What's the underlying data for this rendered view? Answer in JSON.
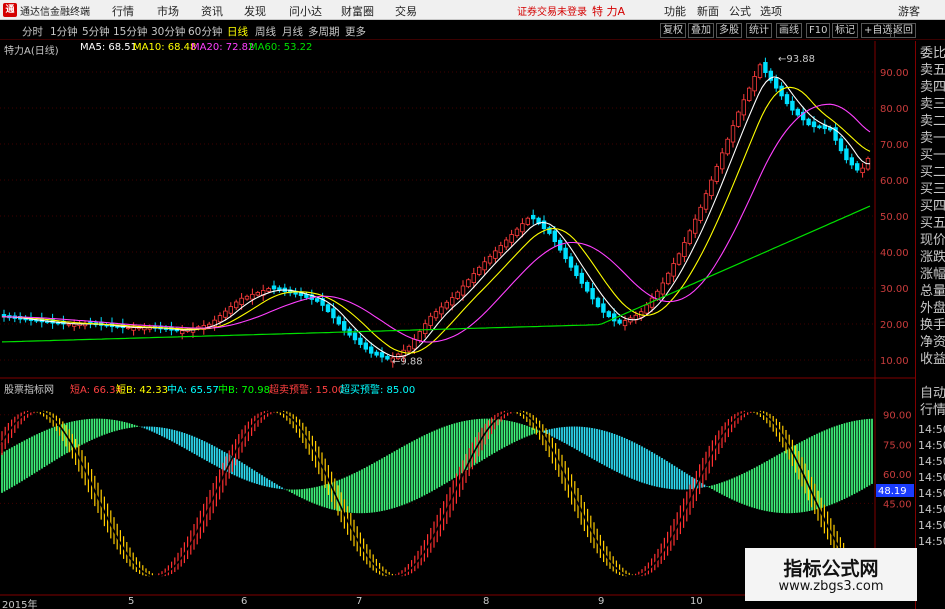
{
  "titlebar": {
    "app_name": "通达信金融终端",
    "menu": [
      "行情",
      "市场",
      "资讯",
      "发现",
      "问小达",
      "财富圈",
      "交易"
    ],
    "notice": "证券交易未登录",
    "stock": "特 力A",
    "right_menu": [
      "功能",
      "新面",
      "公式",
      "选项"
    ],
    "guest": "游客"
  },
  "toolbar": {
    "periods": [
      "分时",
      "1分钟",
      "5分钟",
      "15分钟",
      "30分钟",
      "60分钟",
      "日线",
      "周线",
      "月线",
      "多周期",
      "更多"
    ],
    "active": "日线",
    "right_buttons": [
      "复权",
      "叠加",
      "多股",
      "统计",
      "画线",
      "F10",
      "标记",
      "+自选",
      "返回"
    ]
  },
  "main_legend": {
    "title": "特力A(日线)",
    "ma5": "MA5: 68.51",
    "ma10": "MA10: 68.48",
    "ma20": "MA20: 72.82",
    "ma60": "MA60: 53.22"
  },
  "indicator_legend": {
    "name": "股票指标网",
    "a": "短A: 66.34",
    "b": "短B: 42.33",
    "c": "中A: 65.57",
    "d": "中B: 70.98",
    "sell": "超卖预警: 15.00",
    "buy": "超买预警: 85.00"
  },
  "price_axis": [
    "90.00",
    "80.00",
    "70.00",
    "60.00",
    "50.00",
    "40.00",
    "30.00",
    "20.00",
    "10.00"
  ],
  "ind_axis": [
    "90.00",
    "75.00",
    "60.00",
    "45.00"
  ],
  "ind_value": "48.19",
  "annotations": {
    "high": "93.88",
    "low": "9.88"
  },
  "x_axis": [
    "2015年",
    "5",
    "6",
    "7",
    "8",
    "9",
    "10"
  ],
  "sidebar": {
    "items": [
      "委比",
      "卖五",
      "卖四",
      "卖三",
      "卖二",
      "卖一",
      "买一",
      "买二",
      "买三",
      "买四",
      "买五",
      "现价",
      "涨跌",
      "涨幅",
      "总量",
      "外盘",
      "换手",
      "净资",
      "收益"
    ],
    "lower": [
      "自动",
      "行情"
    ],
    "times": [
      "14:50",
      "14:50",
      "14:50",
      "14:50",
      "14:50",
      "14:50",
      "14:50",
      "14:50"
    ]
  },
  "watermark": {
    "line1": "指标公式网",
    "line2": "www.zbgs3.com"
  },
  "colors": {
    "up": "#ff3c3c",
    "down": "#00e0ff",
    "ma5": "#ffffff",
    "ma10": "#ffff00",
    "ma20": "#ff40ff",
    "ma60": "#00e000"
  }
}
